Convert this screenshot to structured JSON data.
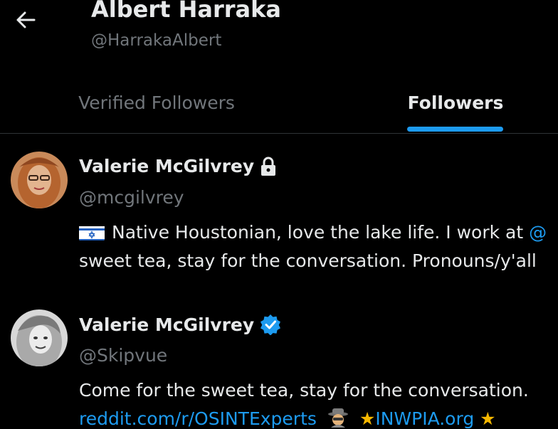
{
  "header": {
    "back_icon": "arrow-left-icon",
    "name": "Albert Harraka",
    "handle": "@HarrakaAlbert"
  },
  "tabs": [
    {
      "label": "Verified Followers",
      "active": false
    },
    {
      "label": "Followers",
      "active": true
    }
  ],
  "colors": {
    "accent": "#1d9bf0",
    "background": "#000000",
    "text_primary": "#e7e9ea",
    "text_secondary": "#71767b",
    "star": "#f5b700"
  },
  "users": [
    {
      "name": "Valerie McGilvrey",
      "badge_icon": "lock-icon",
      "handle": "@mcgilvrey",
      "bio_line1_flag_icon": "israel-flag-icon",
      "bio_line1_text": "Native Houstonian, love the lake life. I work at ",
      "bio_line1_link": "@",
      "bio_line2_text": "sweet tea, stay for the conversation. Pronouns/y'all"
    },
    {
      "name": "Valerie McGilvrey",
      "badge_icon": "verified-badge-icon",
      "handle": "@Skipvue",
      "bio_line1_text": "Come for the sweet tea, stay for the conversation. ",
      "bio_line2_link1": "reddit.com/r/OSINTExperts",
      "bio_line2_spy_icon": "spy-emoji-icon",
      "bio_line2_star1": "★",
      "bio_line2_link2": "INWPIA.org",
      "bio_line2_star2": "★"
    }
  ]
}
